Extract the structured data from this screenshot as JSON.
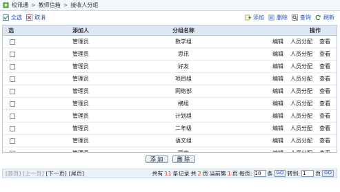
{
  "breadcrumb": {
    "items": [
      "校讯通",
      "教师信箱",
      "接收人分组"
    ],
    "separator": ">"
  },
  "toolbar": {
    "select_all": "全选",
    "cancel": "取消",
    "add": "添加",
    "delete": "删除",
    "query": "查询",
    "refresh": "刷新"
  },
  "table": {
    "headers": {
      "select": "选",
      "added_by": "添加人",
      "group_name": "分组名称",
      "actions": "操作"
    },
    "action_labels": {
      "edit": "编辑",
      "assign": "人员分配",
      "view": "查看"
    },
    "rows": [
      {
        "added_by": "管理员",
        "group_name": "数学组"
      },
      {
        "added_by": "管理员",
        "group_name": "思讯"
      },
      {
        "added_by": "管理员",
        "group_name": "好友"
      },
      {
        "added_by": "管理员",
        "group_name": "项目组"
      },
      {
        "added_by": "管理员",
        "group_name": "网络部"
      },
      {
        "added_by": "管理员",
        "group_name": "横组"
      },
      {
        "added_by": "管理员",
        "group_name": "计划组"
      },
      {
        "added_by": "管理员",
        "group_name": "二年级"
      },
      {
        "added_by": "管理员",
        "group_name": "语文组"
      },
      {
        "added_by": "管理员",
        "group_name": "同事"
      }
    ]
  },
  "buttons": {
    "add": "添 加",
    "delete": "删 除"
  },
  "pager": {
    "first": "[首页]",
    "prev": "[上一页]",
    "next": "[下一页]",
    "last": "[尾页]",
    "total_prefix": "共有",
    "total_count": "11",
    "total_suffix": "条记录",
    "pages_prefix": "共",
    "pages_count": "2",
    "pages_suffix": "页",
    "current_prefix": "当前第",
    "current_page": "1",
    "current_suffix": "页",
    "per_page_label": "每页:",
    "per_page_value": "10",
    "per_page_unit": "条",
    "go_label": "GO",
    "jump_label": "转到:",
    "jump_value": "1",
    "jump_unit": "页"
  },
  "colors": {
    "link": "#1f4fb4",
    "header_bg": "#dde8f4",
    "highlight": "#d52b1e"
  }
}
